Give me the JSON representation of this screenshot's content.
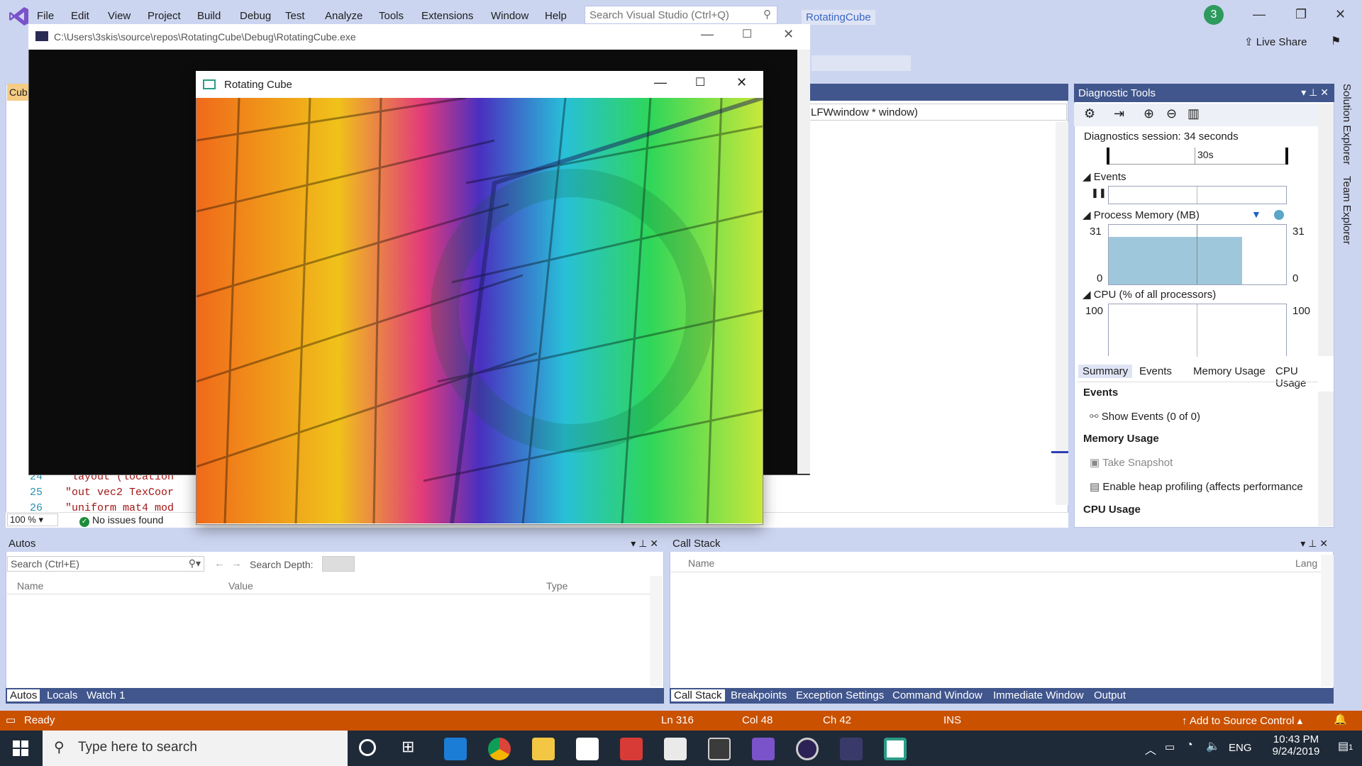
{
  "menubar": {
    "items": [
      "File",
      "Edit",
      "View",
      "Project",
      "Build",
      "Debug",
      "Test",
      "Analyze",
      "Tools",
      "Extensions",
      "Window",
      "Help"
    ],
    "search_placeholder": "Search Visual Studio (Ctrl+Q)",
    "project_name": "RotatingCube",
    "notifications": "3",
    "live_share": "Live Share"
  },
  "console": {
    "title": "C:\\Users\\3skis\\source\\repos\\RotatingCube\\Debug\\RotatingCube.exe"
  },
  "cube_window": {
    "title": "Rotating Cube"
  },
  "editor": {
    "tab_label": "Cub",
    "nav_combo": "LFWwindow * window)",
    "lines": [
      {
        "num": "24",
        "text": "\"layout (location"
      },
      {
        "num": "25",
        "text": "\"out vec2 TexCoor"
      },
      {
        "num": "26",
        "text": "\"uniform mat4 mod"
      }
    ],
    "zoom": "100 %",
    "issues": "No issues found"
  },
  "diagnostics": {
    "title": "Diagnostic Tools",
    "session": "Diagnostics session: 34 seconds",
    "timeline_label": "30s",
    "events_label": "Events",
    "memory_label": "Process Memory (MB)",
    "memory_max": "31",
    "memory_min": "0",
    "memory_max_right": "31",
    "memory_min_right": "0",
    "memory_fill_fraction": 0.8,
    "cpu_label": "CPU (% of all processors)",
    "cpu_max": "100",
    "cpu_max_right": "100",
    "tabs": [
      "Summary",
      "Events",
      "Memory Usage",
      "CPU Usage"
    ],
    "summary": {
      "events_header": "Events",
      "show_events": "Show Events (0 of 0)",
      "memory_header": "Memory Usage",
      "take_snapshot": "Take Snapshot",
      "heap_profiling": "Enable heap profiling (affects performance",
      "cpu_header": "CPU Usage"
    }
  },
  "side_tabs": [
    "Solution Explorer",
    "Team Explorer"
  ],
  "autos": {
    "title": "Autos",
    "search_placeholder": "Search (Ctrl+E)",
    "search_depth_label": "Search Depth:",
    "columns": [
      "Name",
      "Value",
      "Type"
    ],
    "tabs": [
      "Autos",
      "Locals",
      "Watch 1"
    ]
  },
  "callstack": {
    "title": "Call Stack",
    "columns": [
      "Name",
      "Lang"
    ],
    "tabs": [
      "Call Stack",
      "Breakpoints",
      "Exception Settings",
      "Command Window",
      "Immediate Window",
      "Output"
    ]
  },
  "statusbar": {
    "ready": "Ready",
    "ln": "Ln 316",
    "col": "Col 48",
    "ch": "Ch 42",
    "ins": "INS",
    "source_control": "Add to Source Control"
  },
  "taskbar": {
    "search_placeholder": "Type here to search",
    "lang": "ENG",
    "time": "10:43 PM",
    "date": "9/24/2019",
    "notif_count": "1"
  },
  "colors": {
    "accent": "#40568d",
    "status": "#ca5100",
    "chrome": "#ccd5f0"
  }
}
